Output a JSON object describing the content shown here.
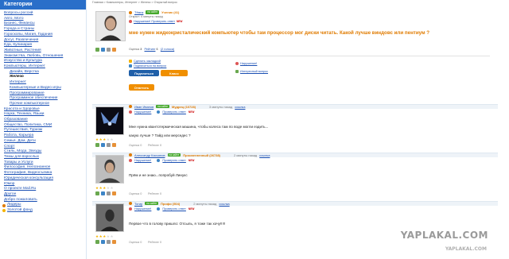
{
  "sidebar": {
    "title": "Категории",
    "items": [
      {
        "label": "Вопросы россий",
        "sub": false
      },
      {
        "label": "Авто, Мото",
        "sub": false
      },
      {
        "label": "Бизнес, Финансы",
        "sub": false
      },
      {
        "label": "Города и Страны",
        "sub": false
      },
      {
        "label": "Гороскопы, Магия, Гадания",
        "sub": false
      },
      {
        "label": "Досуг, Развлечения",
        "sub": false
      },
      {
        "label": "Еда, Кулинария",
        "sub": false
      },
      {
        "label": "Животные, Растения",
        "sub": false
      },
      {
        "label": "Знакомства, Любовь, Отношения",
        "sub": false
      },
      {
        "label": "Искусство и Культура",
        "sub": false
      },
      {
        "label": "Компьютеры, Интернет",
        "sub": false
      },
      {
        "label": "Дизайн, Верстка",
        "sub": true
      },
      {
        "label": "Железо",
        "sub": true,
        "active": true
      },
      {
        "label": "Интернет",
        "sub": true
      },
      {
        "label": "Компьютерные и Видео игры",
        "sub": true
      },
      {
        "label": "Программирование",
        "sub": true
      },
      {
        "label": "Программное обеспечение",
        "sub": true
      },
      {
        "label": "Прочие компьютерное",
        "sub": true
      },
      {
        "label": "Красота и Здоровье",
        "sub": false
      },
      {
        "label": "Наука, Техника, Языки",
        "sub": false
      },
      {
        "label": "Образование",
        "sub": false
      },
      {
        "label": "Общество, Политика, СМИ",
        "sub": false
      },
      {
        "label": "Путешествия, Туризм",
        "sub": false
      },
      {
        "label": "Работа, Карьера",
        "sub": false
      },
      {
        "label": "Семья, Дом, Дети",
        "sub": false
      },
      {
        "label": "Спорт",
        "sub": false
      },
      {
        "label": "Стиль, Мода, Звезды",
        "sub": false
      },
      {
        "label": "Темы для взрослых",
        "sub": false
      },
      {
        "label": "Товары и Услуги",
        "sub": false
      },
      {
        "label": "Философия, Непознанное",
        "sub": false
      },
      {
        "label": "Фотография, Видеосъемка",
        "sub": false
      },
      {
        "label": "Юридическая консультация",
        "sub": false
      },
      {
        "label": "Юмор",
        "sub": false
      },
      {
        "label": "О проекте Mail.Ru",
        "sub": false
      },
      {
        "label": "Другое",
        "sub": false
      },
      {
        "label": "Добро пожаловать",
        "sub": false
      }
    ],
    "extra": [
      {
        "label": "Лидеры",
        "color": "#e07b00"
      },
      {
        "label": "Золотой фонд",
        "color": "#f5b400"
      }
    ]
  },
  "breadcrumb": "Главная > Компьютеры, Интернет > Железо > Открытый вопрос",
  "question": {
    "user": "Тёмик",
    "status": "на сайте",
    "rank": "Ученик (41)",
    "meta1": "Открыт: 4 минуты назад",
    "complain": "Нарушение! Проверить ответ",
    "flag": "NEW",
    "text": "мне нужен жидкокристалический компьютер чтобы там процессор мог диски читать. Какой лучше виндовс или пентиум ?",
    "rating_label": "Оценка",
    "rating_value": "3",
    "rating_word": "Рейтинг",
    "rating_score": "6",
    "votes": "(2 голоса)",
    "bookmark": "Сделать закладкой",
    "subscribe": "Подписаться на вопрос",
    "share_button": "Поделиться",
    "vk_button": "Класс",
    "complaint": "Нарушение!",
    "interesting": "Интересный вопрос",
    "reply_button": "Ответить"
  },
  "answers": [
    {
      "user": "Иван Иванов",
      "status": "на сайте",
      "rank": "Мудрец (10728)",
      "time": "3 минуты назад",
      "link": "ссылка",
      "complain": "Нарушение!",
      "check": "Проверить ответ",
      "flag": "NEW",
      "lines": [
        "Мне нужна квантотермическая машина, чтобы колеса там по воде могли ездить...",
        "какую лучше ? Тайд или мерседес ?"
      ],
      "rating": "Оценка 0",
      "likes": "Рейтинг 0",
      "stars": 3
    },
    {
      "user": "Александр Касьянов",
      "status": "на сайте",
      "rank": "Просветленный (26738)",
      "time": "2 минуты назад",
      "link": "ссылка",
      "complain": "Нарушение!",
      "check": "Проверить ответ",
      "flag": "NEW",
      "lines": [
        "Прём и не знаю...попробуй Линукс"
      ],
      "rating": "Оценка 0",
      "likes": "Рейтинг 0",
      "stars": 3
    },
    {
      "user": "Тогир",
      "status": "на сайте",
      "rank": "Профи (504)",
      "time": "2 минуты назад",
      "link": "ссылка",
      "complain": "Нарушение!",
      "check": "Проверить ответ",
      "flag": "NEW",
      "lines": [
        "Первое что в голову пришло: Отсыль, я тоже так хочу!!!!!"
      ],
      "rating": "Оценка 0",
      "likes": "Рейтинг 0",
      "stars": 3
    }
  ],
  "watermark": {
    "main": "YAPLAKAL.COM",
    "sub": "YAPLAKAL.COM"
  },
  "colors": {
    "accent": "#2a6fc9",
    "question": "#e07b00",
    "online": "#45a82a",
    "star": "#f5b400"
  }
}
